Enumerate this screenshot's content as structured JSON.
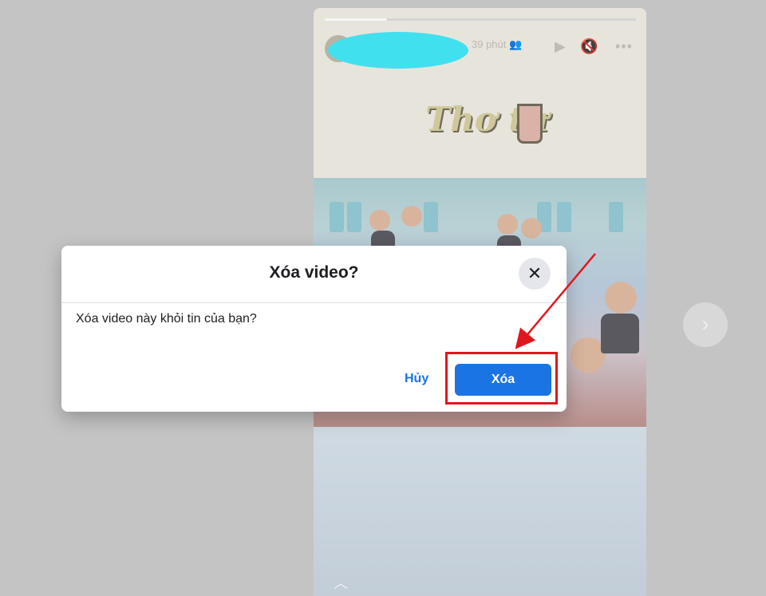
{
  "story": {
    "time_label": "39 phút",
    "audience_icon": "people-icon",
    "sticker_text": "Thơ tư",
    "progress": 0.2
  },
  "dialog": {
    "title": "Xóa video?",
    "message": "Xóa video này khỏi tin của bạn?",
    "cancel_label": "Hủy",
    "confirm_label": "Xóa",
    "close_icon": "close-icon"
  },
  "colors": {
    "accent": "#1b74e4",
    "annotation": "#e0161e",
    "redaction": "#40e0ef"
  }
}
